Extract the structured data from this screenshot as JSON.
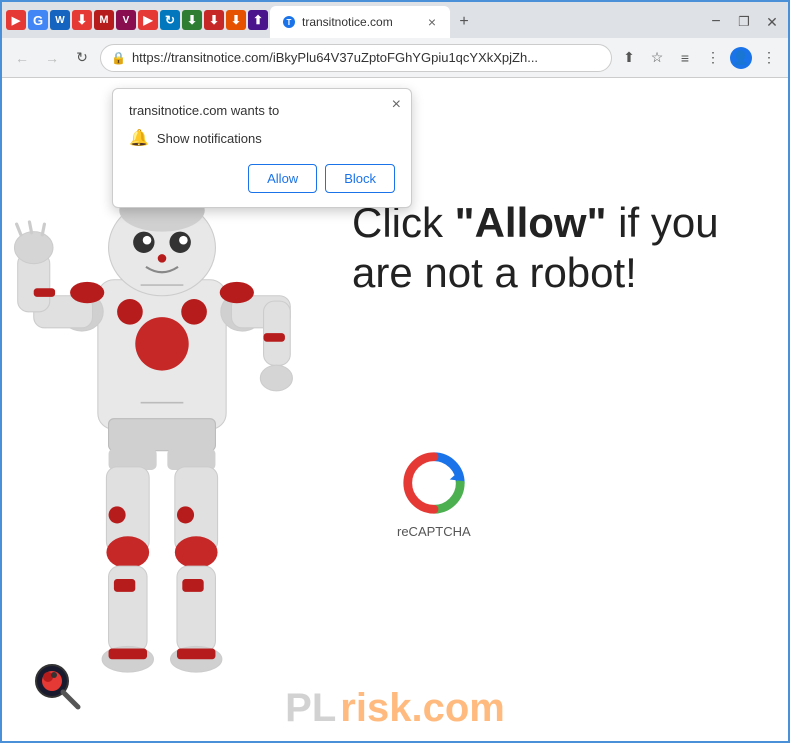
{
  "browser": {
    "title": "transitnotice.com",
    "url": "https://transitnotice.com/iBkyPlu64V37uZptoFGhYGpiu1qcYXkXpjZh...",
    "tab_label": "transitnotice.com",
    "back_disabled": true,
    "forward_disabled": true
  },
  "popup": {
    "title": "transitnotice.com wants to",
    "notification_text": "Show notifications",
    "allow_label": "Allow",
    "block_label": "Block",
    "close_label": "×"
  },
  "page": {
    "main_text_plain": "Click ",
    "main_text_bold": "\"Allow\"",
    "main_text_end": " if you are not a robot!",
    "recaptcha_label": "reCAPTCHA"
  },
  "watermark": {
    "text": "risk.com",
    "prefix": "PL"
  }
}
